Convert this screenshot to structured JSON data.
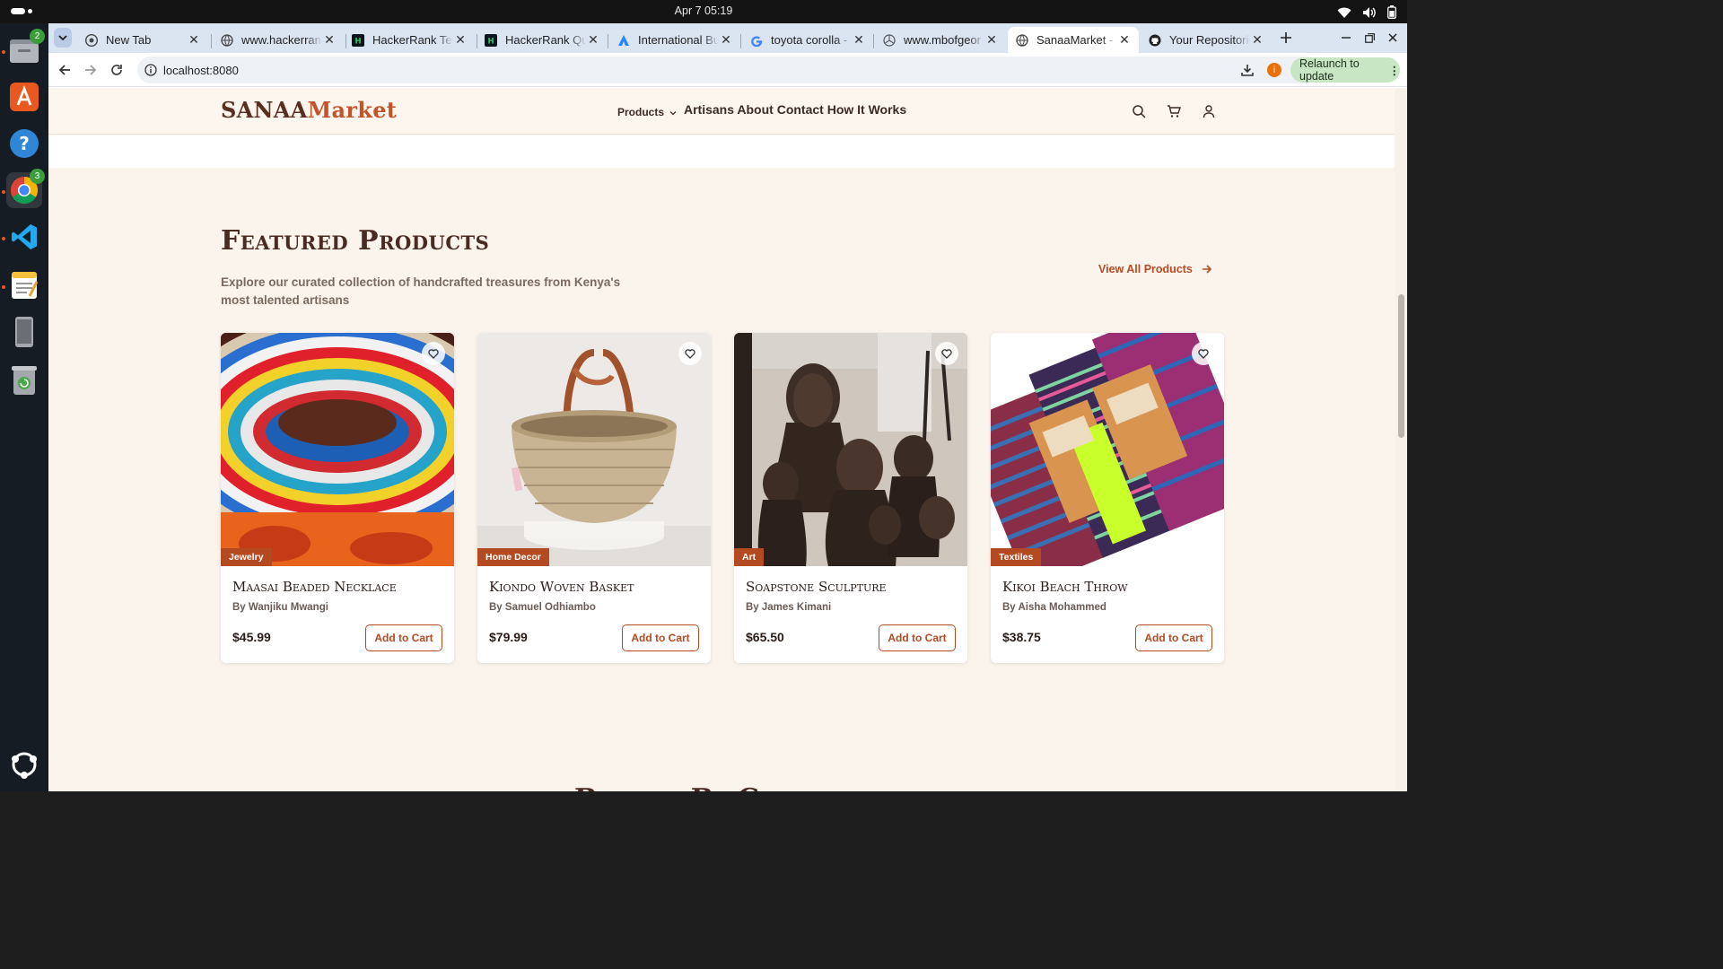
{
  "system": {
    "clock": "Apr 7  05:19",
    "dock": {
      "files_badge": "2",
      "chrome_badge": "3"
    }
  },
  "browser": {
    "tabs": [
      {
        "title": "New Tab",
        "icon": "chrome-icon"
      },
      {
        "title": "www.hackerrank",
        "icon": "globe-icon"
      },
      {
        "title": "HackerRank Test",
        "icon": "hackerrank-icon"
      },
      {
        "title": "HackerRank Que",
        "icon": "hackerrank-icon"
      },
      {
        "title": "International Bu",
        "icon": "atlassian-icon"
      },
      {
        "title": "toyota corolla - (",
        "icon": "google-icon"
      },
      {
        "title": "www.mbofgeor",
        "icon": "mercedes-icon"
      },
      {
        "title": "SanaaMarket - A",
        "icon": "globe-icon",
        "active": true
      },
      {
        "title": "Your Repositorie",
        "icon": "github-icon"
      }
    ],
    "url": "localhost:8080",
    "profile_initial": "i",
    "relaunch_label": "Relaunch to update"
  },
  "site": {
    "logo_part1": "SANAA",
    "logo_part2": "Market",
    "nav": {
      "products": "Products",
      "links": "Artisans About Contact How It Works"
    },
    "featured": {
      "title": "Featured Products",
      "subtitle": "Explore our curated collection of handcrafted treasures from Kenya's most talented artisans",
      "view_all": "View All Products",
      "products": [
        {
          "category": "Jewelry",
          "name": "Maasai Beaded Necklace",
          "artist": "By Wanjiku Mwangi",
          "price": "$45.99",
          "cart": "Add to Cart"
        },
        {
          "category": "Home Decor",
          "name": "Kiondo Woven Basket",
          "artist": "By Samuel Odhiambo",
          "price": "$79.99",
          "cart": "Add to Cart"
        },
        {
          "category": "Art",
          "name": "Soapstone Sculpture",
          "artist": "By James Kimani",
          "price": "$65.50",
          "cart": "Add to Cart"
        },
        {
          "category": "Textiles",
          "name": "Kikoi Beach Throw",
          "artist": "By Aisha Mohammed",
          "price": "$38.75",
          "cart": "Add to Cart"
        }
      ]
    },
    "browse_title": "Browse By Category"
  },
  "colors": {
    "brand_dark": "#5a2f1f",
    "brand_accent": "#c4532a",
    "tag_bg": "#b34a22",
    "page_bg": "#fbf4ec"
  }
}
